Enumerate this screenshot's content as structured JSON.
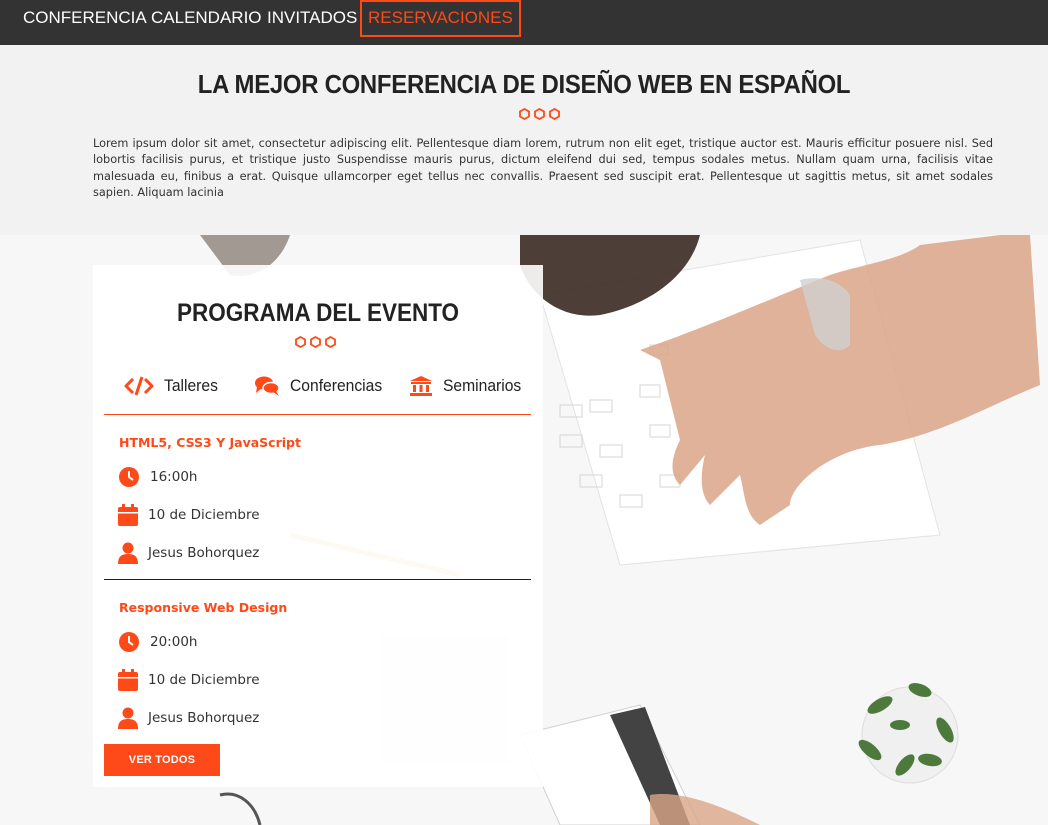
{
  "nav": {
    "items": [
      {
        "label": "CONFERENCIA"
      },
      {
        "label": "CALENDARIO"
      },
      {
        "label": "INVITADOS"
      },
      {
        "label": "RESERVACIONES",
        "active": true
      }
    ]
  },
  "intro": {
    "title": "LA MEJOR CONFERENCIA DE DISEÑO WEB EN ESPAÑOL",
    "text": "Lorem ipsum dolor sit amet, consectetur adipiscing elit. Pellentesque diam lorem, rutrum non elit eget, tristique auctor est. Mauris efficitur posuere nisl. Sed lobortis facilisis purus, et tristique justo Suspendisse mauris purus, dictum eleifend dui sed, tempus sodales metus. Nullam quam urna, facilisis vitae malesuada eu, finibus a erat. Quisque ullamcorper eget tellus nec convallis. Praesent sed suscipit erat. Pellentesque ut sagittis metus, sit amet sodales sapien. Aliquam lacinia"
  },
  "program": {
    "title": "PROGRAMA DEL EVENTO",
    "tabs": [
      {
        "label": "Talleres",
        "icon": "code-icon"
      },
      {
        "label": "Conferencias",
        "icon": "comments-icon"
      },
      {
        "label": "Seminarios",
        "icon": "university-icon"
      }
    ],
    "events": [
      {
        "title": "HTML5, CSS3 Y JavaScript",
        "time": "16:00h",
        "date": "10 de Diciembre",
        "speaker": "Jesus Bohorquez"
      },
      {
        "title": "Responsive Web Design",
        "time": "20:00h",
        "date": "10 de Diciembre",
        "speaker": "Jesus Bohorquez"
      }
    ],
    "button_label": "VER TODOS"
  },
  "colors": {
    "accent": "#fe4918",
    "nav_bg": "#333333",
    "intro_bg": "#f2f2f2"
  }
}
